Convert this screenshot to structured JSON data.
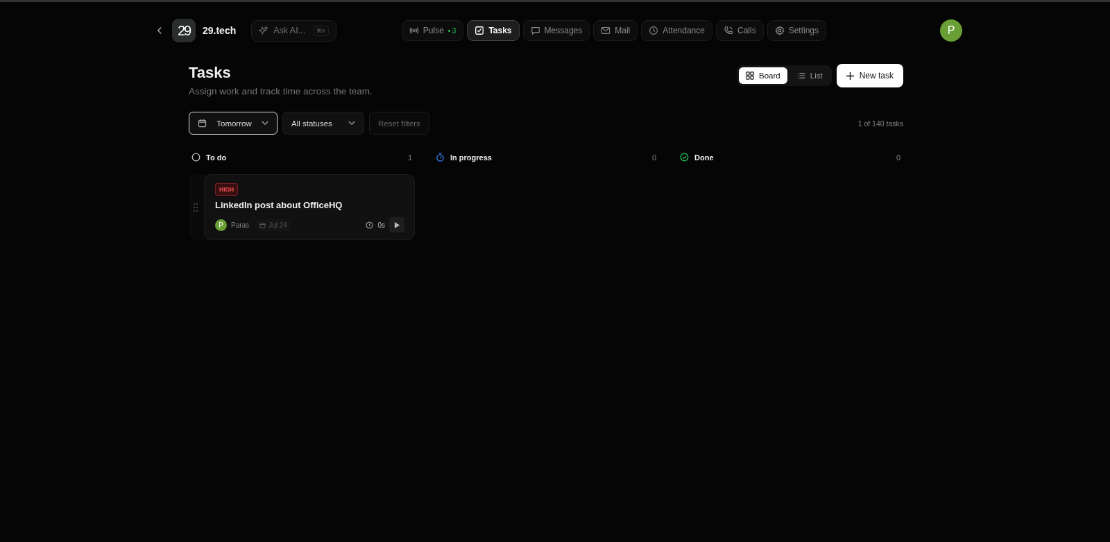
{
  "brand": {
    "logo": "29",
    "name": "29.tech"
  },
  "ask": {
    "label": "Ask AI...",
    "shortcut": "⌘K"
  },
  "nav": [
    {
      "kind": "pulse",
      "label": "Pulse",
      "badge": "3",
      "selected": false
    },
    {
      "kind": "tasks",
      "label": "Tasks",
      "selected": true
    },
    {
      "kind": "messages",
      "label": "Messages",
      "selected": false
    },
    {
      "kind": "mail",
      "label": "Mail",
      "selected": false
    },
    {
      "kind": "attendance",
      "label": "Attendance",
      "selected": false
    },
    {
      "kind": "calls",
      "label": "Calls",
      "selected": false
    },
    {
      "kind": "settings",
      "label": "Settings",
      "selected": false
    }
  ],
  "avatar": {
    "initial": "P"
  },
  "page": {
    "title": "Tasks",
    "subtitle": "Assign work and track time across the team."
  },
  "views": [
    {
      "kind": "board",
      "label": "Board",
      "selected": true
    },
    {
      "kind": "list",
      "label": "List",
      "selected": false
    }
  ],
  "new_task": "New task",
  "filters": {
    "date": "Tomorrow",
    "status": "All statuses",
    "reset": "Reset filters",
    "count": "1 of 140 tasks"
  },
  "columns": [
    {
      "kind": "todo",
      "title": "To do",
      "count": "1",
      "cards": [
        {
          "priority": "HIGH",
          "title": "LinkedIn post about OfficeHQ",
          "assignee": "Paras",
          "assignee_initial": "P",
          "date": "Jul 24",
          "time": "0s"
        }
      ]
    },
    {
      "kind": "progress",
      "title": "In progress",
      "count": "0"
    },
    {
      "kind": "done",
      "title": "Done",
      "count": "0"
    }
  ]
}
